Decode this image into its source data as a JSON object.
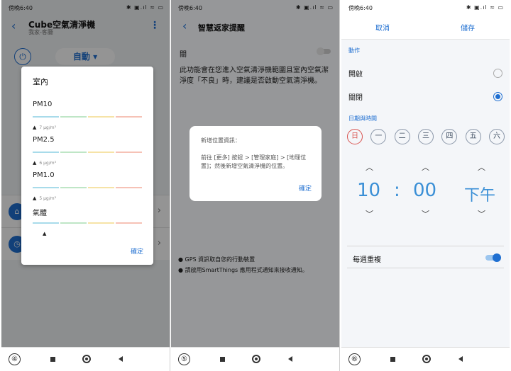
{
  "status_bar": {
    "time": "傍晚6:40",
    "icons": "✱ ▣.ıl ≈ ▭"
  },
  "nav_buttons": [
    "square-icon",
    "home-ring-icon",
    "back-triangle-icon"
  ],
  "screen1": {
    "step": "④",
    "title": "Cube空氣清淨機",
    "subtitle": "我家-客廳",
    "mode": "自動 ▾",
    "dialog": {
      "heading": "室內",
      "metrics": [
        {
          "name": "PM10",
          "value": "7 μg/m³"
        },
        {
          "name": "PM2.5",
          "value": "6 μg/m³"
        },
        {
          "name": "PM1.0",
          "value": "5 μg/m³"
        },
        {
          "name": "氣體",
          "value": ""
        }
      ],
      "ok": "確定"
    }
  },
  "screen2": {
    "step": "⑤",
    "title": "智慧返家提醒",
    "toggle_label": "關",
    "toggle_on": false,
    "description": "此功能會在您進入空氣清淨機範圍且室內空氣潔淨度「不良」時，建議是否啟動空氣清淨機。",
    "dialog": {
      "heading": "新增位置資訊：",
      "body": "前往 [更多] 按鈕 > [管理家庭] > [地理位置]；然後新增空氣清淨機的位置。",
      "ok": "確定"
    },
    "notes": [
      "● GPS 資訊取自您的行動裝置",
      "● 請啟用SmartThings 應用程式通知來接收通知。"
    ]
  },
  "screen3": {
    "step": "⑥",
    "cancel": "取消",
    "save": "儲存",
    "action_section": "動作",
    "options": [
      {
        "label": "開啟",
        "selected": false
      },
      {
        "label": "關閉",
        "selected": true
      }
    ],
    "datetime_section": "日期與時間",
    "days": [
      "日",
      "一",
      "二",
      "三",
      "四",
      "五",
      "六"
    ],
    "hour": "10",
    "separator": ":",
    "minute": "00",
    "ampm": "下午",
    "repeat_label": "每週重複",
    "repeat_on": true,
    "colors": {
      "accent": "#1f6fd1",
      "time": "#3a8fd6",
      "sunday": "#d9534f"
    }
  }
}
